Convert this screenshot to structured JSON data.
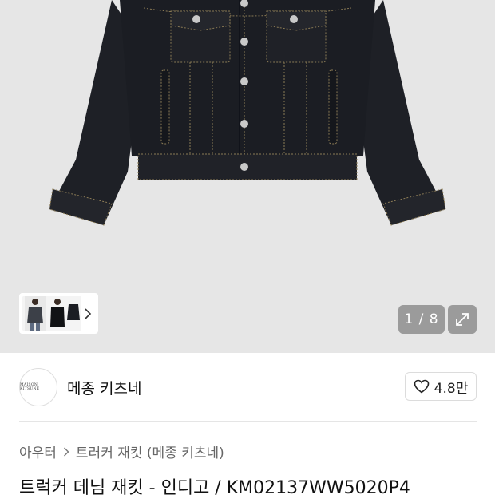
{
  "gallery": {
    "counter": "1 / 8",
    "colors": {
      "jacket": "#1e2026",
      "stitch": "#8a7a55",
      "button": "#c9c9c9",
      "badge": "#9b9b9b"
    }
  },
  "icons": {
    "thumb_next": "chevron-right-icon",
    "expand": "expand-arrows-icon",
    "like": "heart-outline-icon"
  },
  "brand": {
    "logo_text": "MAISON KITSUNÉ",
    "name": "메종 키츠네",
    "likes": "4.8만"
  },
  "breadcrumb": {
    "items": [
      "아우터",
      "트러커 재킷 (메종 키츠네)"
    ]
  },
  "product": {
    "title": "트럭커 데님 재킷 - 인디고 / KM02137WW5020P4"
  }
}
